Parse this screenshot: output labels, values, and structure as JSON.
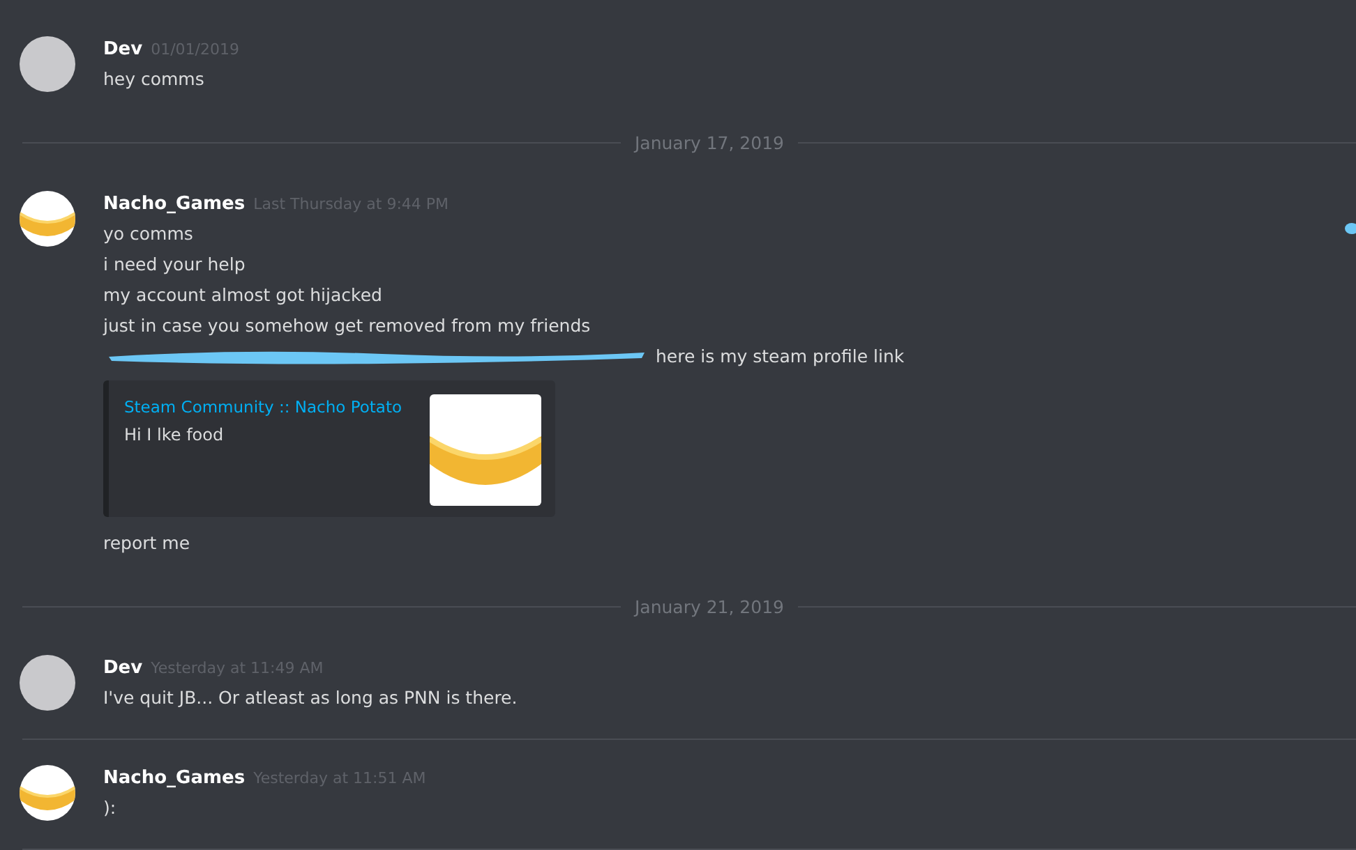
{
  "feed": [
    {
      "kind": "message",
      "author": "Dev",
      "timestamp": "01/01/2019",
      "avatar": {
        "kind": "person"
      },
      "lines": [
        {
          "kind": "text",
          "text": "hey comms"
        }
      ]
    },
    {
      "kind": "divider",
      "text": "January 17, 2019"
    },
    {
      "kind": "message",
      "author": "Nacho_Games",
      "timestamp": "Last Thursday at 9:44 PM",
      "avatar": {
        "kind": "banana"
      },
      "lines": [
        {
          "kind": "text",
          "text": "yo comms"
        },
        {
          "kind": "text",
          "text": "i need your help"
        },
        {
          "kind": "text",
          "text": "my account almost got hijacked"
        },
        {
          "kind": "text",
          "text": "just in case you somehow get removed from my friends"
        },
        {
          "kind": "redacted",
          "text": "here is my steam profile link"
        },
        {
          "kind": "embed",
          "title": "Steam Community :: Nacho Potato",
          "description": "Hi I lke food"
        },
        {
          "kind": "text",
          "text": "report me"
        }
      ]
    },
    {
      "kind": "divider",
      "text": "January 21, 2019"
    },
    {
      "kind": "message",
      "author": "Dev",
      "timestamp": "Yesterday at 11:49 AM",
      "avatar": {
        "kind": "person"
      },
      "lines": [
        {
          "kind": "text",
          "text": "I've quit JB... Or atleast as long as PNN is there."
        }
      ]
    },
    {
      "kind": "separator"
    },
    {
      "kind": "message",
      "author": "Nacho_Games",
      "timestamp": "Yesterday at 11:51 AM",
      "avatar": {
        "kind": "banana"
      },
      "lines": [
        {
          "kind": "text",
          "text": "):"
        }
      ]
    },
    {
      "kind": "separator"
    }
  ]
}
